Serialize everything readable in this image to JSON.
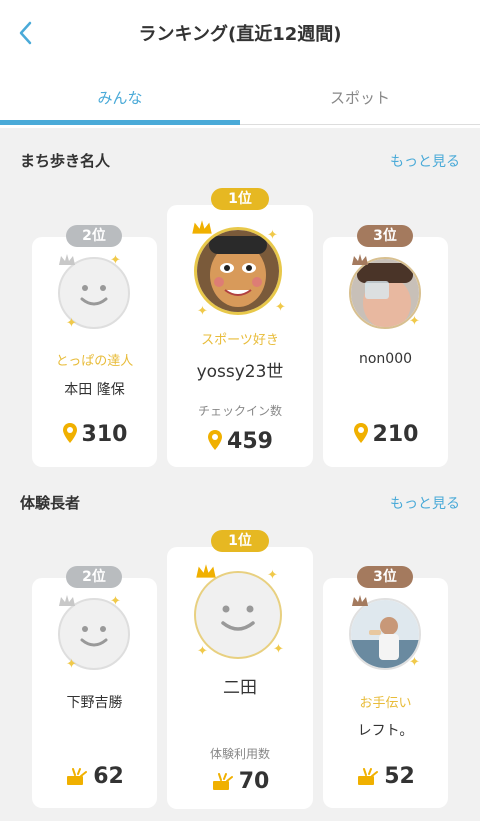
{
  "header": {
    "title": "ランキング(直近12週間)"
  },
  "tabs": [
    {
      "label": "みんな",
      "active": true
    },
    {
      "label": "スポット",
      "active": false
    }
  ],
  "sections": [
    {
      "title": "まち歩き名人",
      "more": "もっと見る",
      "score_icon": "location-pin-icon",
      "first": {
        "rank": "1位",
        "subtitle": "スポーツ好き",
        "name": "yossy23世",
        "label": "チェックイン数",
        "score": "459"
      },
      "second": {
        "rank": "2位",
        "subtitle": "とっぱの達人",
        "name": "本田 隆保",
        "score": "310"
      },
      "third": {
        "rank": "3位",
        "name": "non000",
        "score": "210"
      }
    },
    {
      "title": "体験長者",
      "more": "もっと見る",
      "score_icon": "ticket-icon",
      "first": {
        "rank": "1位",
        "name": "二田",
        "label": "体験利用数",
        "score": "70"
      },
      "second": {
        "rank": "2位",
        "name": "下野吉勝",
        "score": "62"
      },
      "third": {
        "rank": "3位",
        "subtitle": "お手伝い",
        "name": "レフト。",
        "score": "52"
      }
    }
  ],
  "colors": {
    "accent": "#4aaad8",
    "gold": "#e6b822",
    "silver": "#b9bcbf",
    "bronze": "#a47a5e"
  }
}
